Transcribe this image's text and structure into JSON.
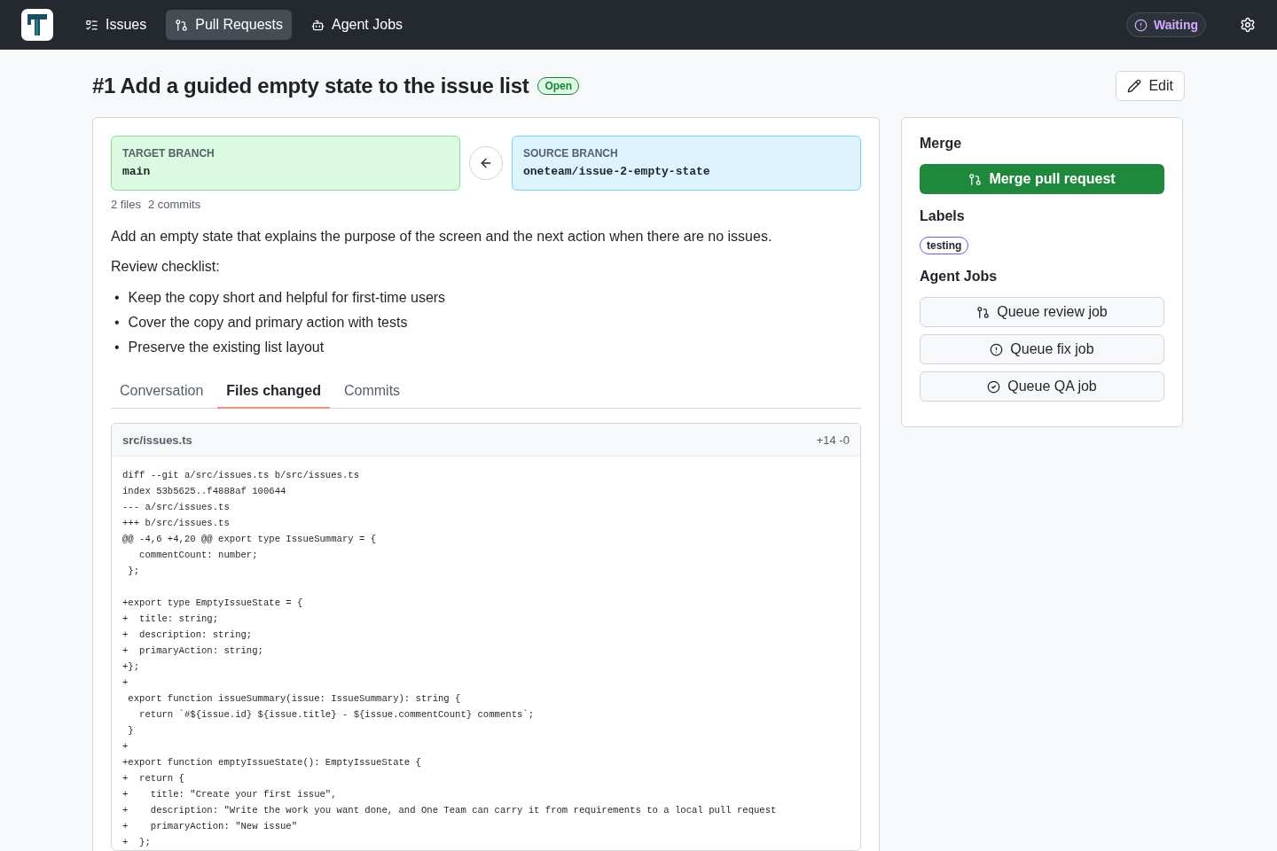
{
  "nav": {
    "items": [
      {
        "label": "Issues",
        "selected": false
      },
      {
        "label": "Pull Requests",
        "selected": true
      },
      {
        "label": "Agent Jobs",
        "selected": false
      }
    ],
    "status": "Waiting"
  },
  "header": {
    "title": "#1 Add a guided empty state to the issue list",
    "state": "Open",
    "edit": "Edit"
  },
  "branches": {
    "target": {
      "label": "TARGET BRANCH",
      "name": "main"
    },
    "source": {
      "label": "SOURCE BRANCH",
      "name": "oneteam/issue-2-empty-state"
    }
  },
  "stats": [
    "2 files",
    "2 commits"
  ],
  "description": "Add an empty state that explains the purpose of the screen and the next action when there are no issues.",
  "checklist": {
    "heading": "Review checklist:",
    "items": [
      {
        "marker": "•",
        "text": "Keep the copy short and helpful for first-time users"
      },
      {
        "marker": "•",
        "text": "Cover the copy and primary action with tests"
      },
      {
        "marker": "•",
        "text": "Preserve the existing list layout"
      }
    ]
  },
  "tabs": [
    {
      "label": "Conversation",
      "selected": false
    },
    {
      "label": "Files changed",
      "selected": true
    },
    {
      "label": "Commits",
      "selected": false
    }
  ],
  "file": {
    "path": "src/issues.ts",
    "stat": "+14 -0",
    "blocks": [
      [
        "diff --git a/src/issues.ts b/src/issues.ts",
        "index 53b5625..f4888af 100644",
        "--- a/src/issues.ts",
        "+++ b/src/issues.ts",
        "@@ -4,6 +4,20 @@ export type IssueSummary = {",
        "   commentCount: number;",
        " };"
      ],
      [
        "+export type EmptyIssueState = {",
        "+  title: string;",
        "+  description: string;",
        "+  primaryAction: string;",
        "+};",
        "+",
        " export function issueSummary(issue: IssueSummary): string {",
        "   return `#${issue.id} ${issue.title} - ${issue.commentCount} comments`;",
        " }",
        "+",
        "+export function emptyIssueState(): EmptyIssueState {",
        "+  return {",
        "+    title: \"Create your first issue\",",
        "+    description: \"Write the work you want done, and One Team can carry it from requirements to a local pull request",
        "+    primaryAction: \"New issue\"",
        "+  };"
      ]
    ]
  },
  "sidebar": {
    "merge": {
      "heading": "Merge",
      "button": "Merge pull request"
    },
    "labels": {
      "heading": "Labels",
      "items": [
        {
          "name": "testing",
          "color": "#8250df"
        }
      ]
    },
    "jobs": {
      "heading": "Agent Jobs",
      "buttons": [
        "Queue review job",
        "Queue fix job",
        "Queue QA job"
      ]
    }
  }
}
